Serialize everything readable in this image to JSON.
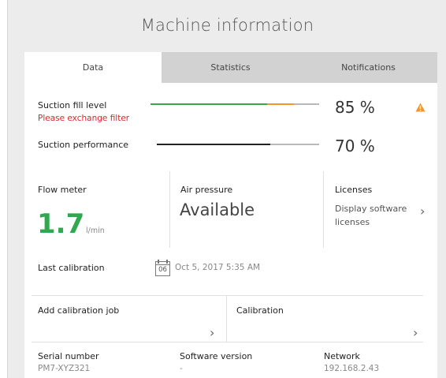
{
  "window": {
    "title": "Machine information"
  },
  "tabs": [
    {
      "label": "Data",
      "active": true
    },
    {
      "label": "Statistics",
      "active": false
    },
    {
      "label": "Notifications",
      "active": false
    }
  ],
  "suction_fill": {
    "label": "Suction fill level",
    "warning": "Please exchange filter",
    "value_label": "85 %",
    "level": 0.85,
    "warning_icon": "warning-triangle-icon",
    "colors": {
      "ok": "#3aa84a",
      "warn": "#f0962b",
      "rest": "#b8b8b8",
      "warning_text": "#d6262e"
    }
  },
  "suction_performance": {
    "label": "Suction performance",
    "value_label": "70 %",
    "level": 0.7,
    "colors": {
      "fill": "#222222",
      "rest": "#b8b8b8"
    }
  },
  "flow_meter": {
    "label": "Flow meter",
    "value": "1.7",
    "unit": "l/min",
    "color": "#2fa84f"
  },
  "air_pressure": {
    "label": "Air pressure",
    "value": "Available"
  },
  "licenses": {
    "label": "Licenses",
    "link_line1": "Display software",
    "link_line2": "licenses",
    "icon": "chevron-right-icon"
  },
  "last_calibration": {
    "label": "Last calibration",
    "calendar_day": "06",
    "value": "Oct 5, 2017 5:35 AM",
    "icon": "calendar-icon"
  },
  "actions": {
    "add_calibration_job": "Add calibration job",
    "calibration": "Calibration"
  },
  "serial": {
    "label": "Serial number",
    "value": "PM7-XYZ321"
  },
  "software": {
    "label": "Software version",
    "value": "-"
  },
  "network": {
    "label": "Network",
    "value": "192.168.2.43"
  }
}
